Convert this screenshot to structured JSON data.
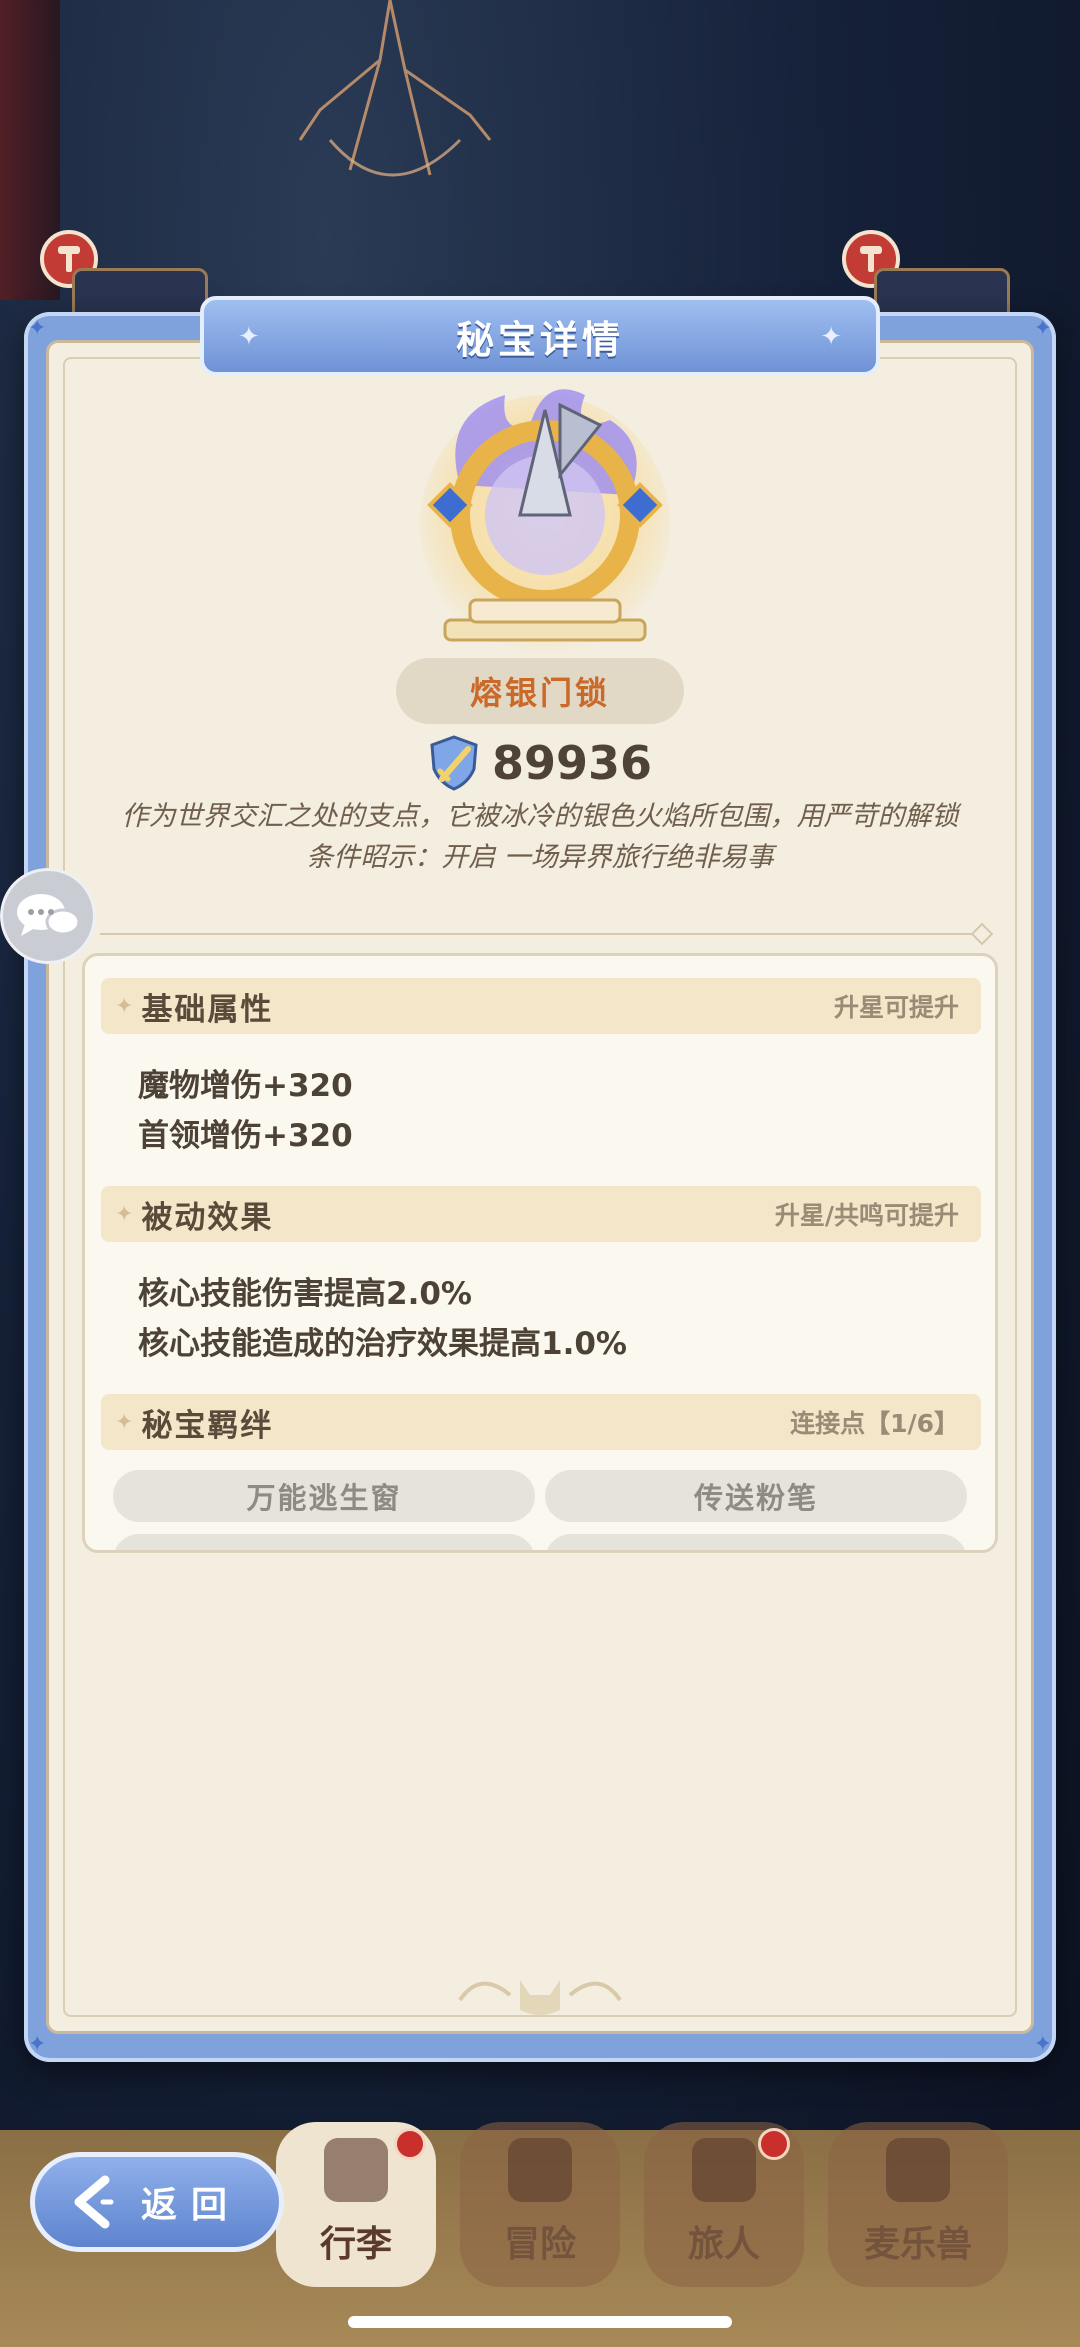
{
  "dialog": {
    "title": "秘宝详情",
    "item_name": "熔银门锁",
    "power": "89936",
    "description": "作为世界交汇之处的支点，它被冰冷的银色火焰所包围，用严苛的解锁条件昭示：开启 一场异界旅行绝非易事"
  },
  "sections": {
    "base": {
      "title": "基础属性",
      "note": "升星可提升",
      "stats": [
        "魔物增伤+320",
        "首领增伤+320"
      ]
    },
    "passive": {
      "title": "被动效果",
      "note": "升星/共鸣可提升",
      "stats": [
        "核心技能伤害提高2.0%",
        "核心技能造成的治疗效果提高1.0%"
      ]
    },
    "bond": {
      "title": "秘宝羁绊",
      "note": "连接点【1/6】",
      "items": [
        "万能逃生窗",
        "传送粉笔"
      ]
    }
  },
  "nav": {
    "back_label": "返回",
    "tabs": [
      "行李",
      "冒险",
      "旅人",
      "麦乐兽"
    ]
  },
  "colors": {
    "frame_blue": "#7fa2dd",
    "paper": "#f4eee0",
    "name_orange": "#c9692a",
    "badge_red": "#c9302c"
  }
}
